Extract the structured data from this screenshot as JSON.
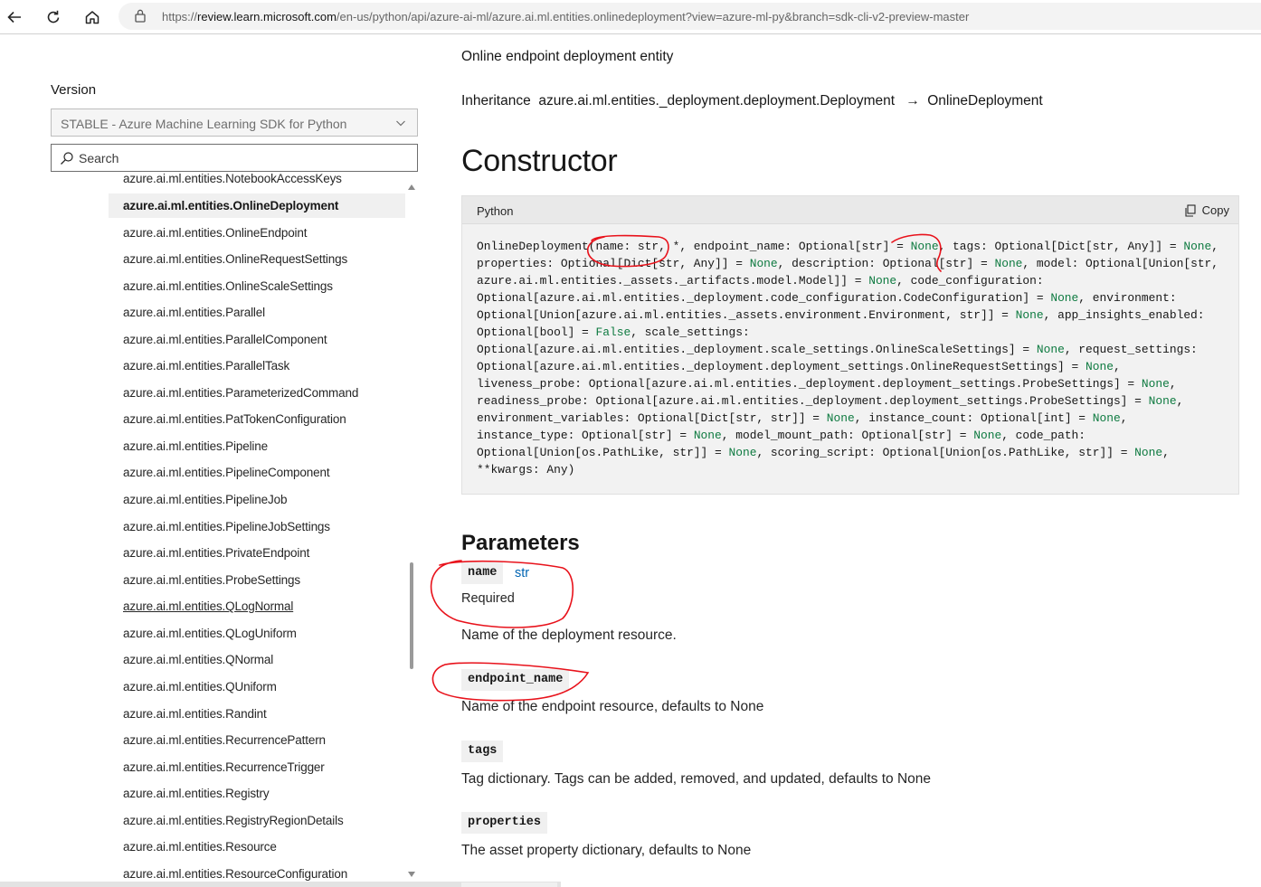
{
  "browser": {
    "url_prefix": "https://",
    "url_host": "review.learn.microsoft.com",
    "url_path": "/en-us/python/api/azure-ai-ml/azure.ai.ml.entities.onlinedeployment?view=azure-ml-py&branch=sdk-cli-v2-preview-master"
  },
  "sidebar": {
    "version_label": "Version",
    "version_selected": "STABLE - Azure Machine Learning SDK for Python",
    "search_placeholder": "Search",
    "items": [
      {
        "label": "azure.ai.ml.entities.NotebookAccessKeys"
      },
      {
        "label": "azure.ai.ml.entities.OnlineDeployment"
      },
      {
        "label": "azure.ai.ml.entities.OnlineEndpoint"
      },
      {
        "label": "azure.ai.ml.entities.OnlineRequestSettings"
      },
      {
        "label": "azure.ai.ml.entities.OnlineScaleSettings"
      },
      {
        "label": "azure.ai.ml.entities.Parallel"
      },
      {
        "label": "azure.ai.ml.entities.ParallelComponent"
      },
      {
        "label": "azure.ai.ml.entities.ParallelTask"
      },
      {
        "label": "azure.ai.ml.entities.ParameterizedCommand"
      },
      {
        "label": "azure.ai.ml.entities.PatTokenConfiguration"
      },
      {
        "label": "azure.ai.ml.entities.Pipeline"
      },
      {
        "label": "azure.ai.ml.entities.PipelineComponent"
      },
      {
        "label": "azure.ai.ml.entities.PipelineJob"
      },
      {
        "label": "azure.ai.ml.entities.PipelineJobSettings"
      },
      {
        "label": "azure.ai.ml.entities.PrivateEndpoint"
      },
      {
        "label": "azure.ai.ml.entities.ProbeSettings"
      },
      {
        "label": "azure.ai.ml.entities.QLogNormal"
      },
      {
        "label": "azure.ai.ml.entities.QLogUniform"
      },
      {
        "label": "azure.ai.ml.entities.QNormal"
      },
      {
        "label": "azure.ai.ml.entities.QUniform"
      },
      {
        "label": "azure.ai.ml.entities.Randint"
      },
      {
        "label": "azure.ai.ml.entities.RecurrencePattern"
      },
      {
        "label": "azure.ai.ml.entities.RecurrenceTrigger"
      },
      {
        "label": "azure.ai.ml.entities.Registry"
      },
      {
        "label": "azure.ai.ml.entities.RegistryRegionDetails"
      },
      {
        "label": "azure.ai.ml.entities.Resource"
      },
      {
        "label": "azure.ai.ml.entities.ResourceConfiguration"
      }
    ]
  },
  "main": {
    "summary": "Online endpoint deployment entity",
    "inheritance_label": "Inheritance",
    "inheritance_base": "azure.ai.ml.entities._deployment.deployment.Deployment",
    "inheritance_arrow": "→",
    "inheritance_class": "OnlineDeployment",
    "constructor_heading": "Constructor",
    "code": {
      "language": "Python",
      "copy_label": "Copy",
      "lines": [
        [
          {
            "t": "OnlineDeployment(name: str, *, endpoint_name: Optional[str] = "
          },
          {
            "t": "None",
            "k": 1
          },
          {
            "t": ", tags: Optional[Dict[str, Any]] = "
          },
          {
            "t": "None",
            "k": 1
          },
          {
            "t": ","
          }
        ],
        [
          {
            "t": "properties: Optional[Dict[str, Any]] = "
          },
          {
            "t": "None",
            "k": 1
          },
          {
            "t": ", description: Optional[str] = "
          },
          {
            "t": "None",
            "k": 1
          },
          {
            "t": ", model: Optional[Union[str,"
          }
        ],
        [
          {
            "t": "azure.ai.ml.entities._assets._artifacts.model.Model]] = "
          },
          {
            "t": "None",
            "k": 1
          },
          {
            "t": ", code_configuration:"
          }
        ],
        [
          {
            "t": "Optional[azure.ai.ml.entities._deployment.code_configuration.CodeConfiguration] = "
          },
          {
            "t": "None",
            "k": 1
          },
          {
            "t": ", environment:"
          }
        ],
        [
          {
            "t": "Optional[Union[azure.ai.ml.entities._assets.environment.Environment, str]] = "
          },
          {
            "t": "None",
            "k": 1
          },
          {
            "t": ", app_insights_enabled:"
          }
        ],
        [
          {
            "t": "Optional[bool] = "
          },
          {
            "t": "False",
            "k": 1
          },
          {
            "t": ", scale_settings:"
          }
        ],
        [
          {
            "t": "Optional[azure.ai.ml.entities._deployment.scale_settings.OnlineScaleSettings] = "
          },
          {
            "t": "None",
            "k": 1
          },
          {
            "t": ", request_settings:"
          }
        ],
        [
          {
            "t": "Optional[azure.ai.ml.entities._deployment.deployment_settings.OnlineRequestSettings] = "
          },
          {
            "t": "None",
            "k": 1
          },
          {
            "t": ","
          }
        ],
        [
          {
            "t": "liveness_probe: Optional[azure.ai.ml.entities._deployment.deployment_settings.ProbeSettings] = "
          },
          {
            "t": "None",
            "k": 1
          },
          {
            "t": ","
          }
        ],
        [
          {
            "t": "readiness_probe: Optional[azure.ai.ml.entities._deployment.deployment_settings.ProbeSettings] = "
          },
          {
            "t": "None",
            "k": 1
          },
          {
            "t": ","
          }
        ],
        [
          {
            "t": "environment_variables: Optional[Dict[str, str]] = "
          },
          {
            "t": "None",
            "k": 1
          },
          {
            "t": ", instance_count: Optional[int] = "
          },
          {
            "t": "None",
            "k": 1
          },
          {
            "t": ","
          }
        ],
        [
          {
            "t": "instance_type: Optional[str] = "
          },
          {
            "t": "None",
            "k": 1
          },
          {
            "t": ", model_mount_path: Optional[str] = "
          },
          {
            "t": "None",
            "k": 1
          },
          {
            "t": ", code_path:"
          }
        ],
        [
          {
            "t": "Optional[Union[os.PathLike, str]] = "
          },
          {
            "t": "None",
            "k": 1
          },
          {
            "t": ", scoring_script: Optional[Union[os.PathLike, str]] = "
          },
          {
            "t": "None",
            "k": 1
          },
          {
            "t": ","
          }
        ],
        [
          {
            "t": "**kwargs: Any)"
          }
        ]
      ]
    },
    "parameters_heading": "Parameters",
    "params": [
      {
        "name": "name",
        "type": "str",
        "required": "Required",
        "desc": "Name of the deployment resource."
      },
      {
        "name": "endpoint_name",
        "desc": "Name of the endpoint resource, defaults to None"
      },
      {
        "name": "tags",
        "desc": "Tag dictionary. Tags can be added, removed, and updated, defaults to None"
      },
      {
        "name": "properties",
        "desc": "The asset property dictionary, defaults to None"
      }
    ]
  },
  "colors": {
    "annotation_red": "#e8121b",
    "keyword_green": "#0e7a40",
    "type_link_blue": "#0065b3"
  }
}
